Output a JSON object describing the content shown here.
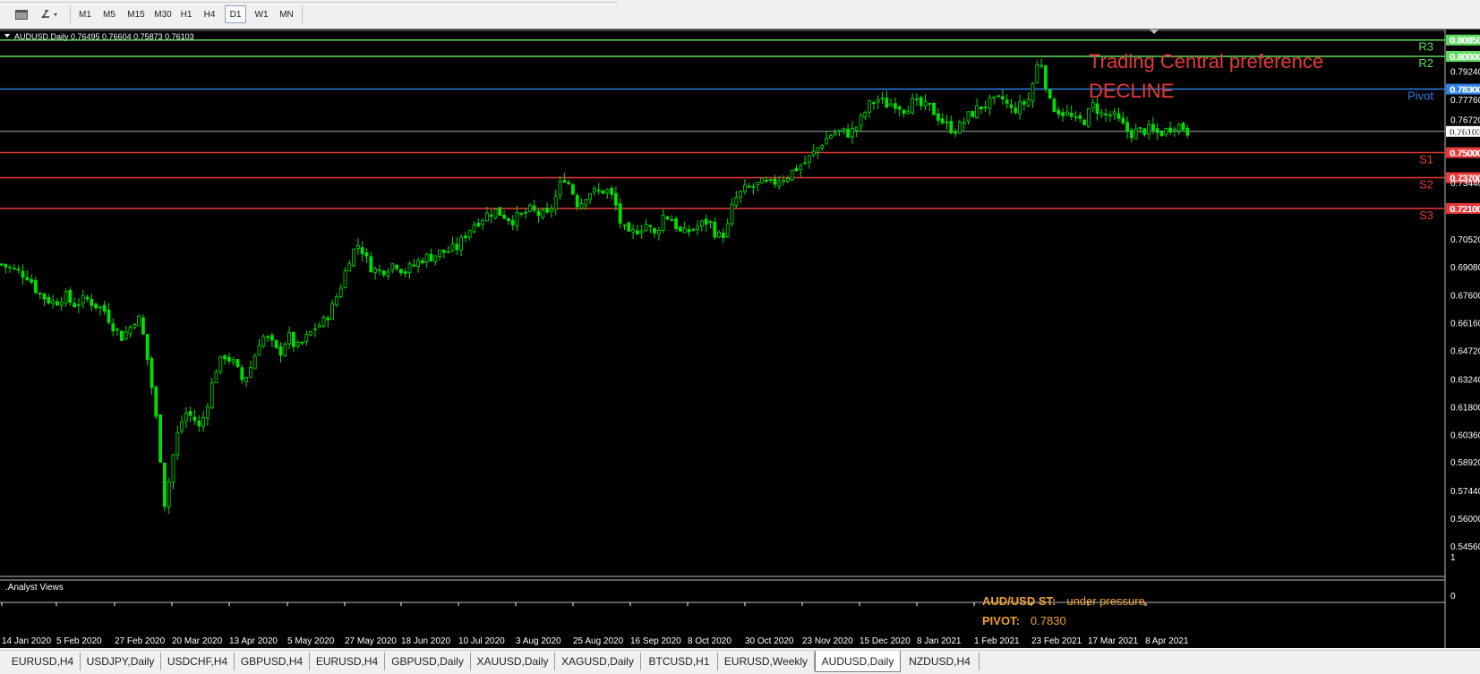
{
  "toolbar": {
    "timeframes": [
      "M1",
      "M5",
      "M15",
      "M30",
      "H1",
      "H4",
      "D1",
      "W1",
      "MN"
    ],
    "active_timeframe": "D1",
    "icons": [
      "chart-window-icon",
      "drawing-tools-icon"
    ]
  },
  "chart": {
    "header": "AUDUSD,Daily  0.76495 0.76604 0.75873 0.76103",
    "symbol": "AUDUSD",
    "timeframe": "Daily",
    "ohlc": {
      "open": "0.76495",
      "high": "0.76604",
      "low": "0.75873",
      "close": "0.76103"
    },
    "current_price": "0.76103",
    "candle_color": "#00e000",
    "price_scale": [
      "0.80850",
      "0.80000",
      "0.79240",
      "0.78300",
      "0.77760",
      "0.76720",
      "0.76103",
      "0.75000",
      "0.73700",
      "0.73440",
      "0.72100",
      "0.70520",
      "0.69080",
      "0.67600",
      "0.66160",
      "0.64720",
      "0.63240",
      "0.61800",
      "0.60360",
      "0.58920",
      "0.57440",
      "0.56000",
      "0.54560"
    ],
    "levels": [
      {
        "name": "R3",
        "value": "0.80850",
        "color": "#5fdc5f"
      },
      {
        "name": "R2",
        "value": "0.80000",
        "color": "#5fdc5f"
      },
      {
        "name": "Pivot",
        "value": "0.78300",
        "color": "#2f7fe8"
      },
      {
        "name": "S1",
        "value": "0.75000",
        "color": "#e83838"
      },
      {
        "name": "S2",
        "value": "0.73700",
        "color": "#e83838"
      },
      {
        "name": "S3",
        "value": "0.72100",
        "color": "#e83838"
      }
    ],
    "preference_title": "Trading Central preference",
    "preference_value": "DECLINE",
    "preference_color": "#e83838",
    "time_axis": [
      "14 Jan 2020",
      "5 Feb 2020",
      "27 Feb 2020",
      "20 Mar 2020",
      "13 Apr 2020",
      "5 May 2020",
      "27 May 2020",
      "18 Jun 2020",
      "10 Jul 2020",
      "3 Aug 2020",
      "25 Aug 2020",
      "16 Sep 2020",
      "8 Oct 2020",
      "30 Oct 2020",
      "23 Nov 2020",
      "15 Dec 2020",
      "8 Jan 2021",
      "1 Feb 2021",
      "23 Feb 2021",
      "17 Mar 2021",
      "8 Apr 2021"
    ]
  },
  "indicator": {
    "name": ".Analyst Views",
    "scale": [
      "1",
      "0"
    ],
    "rows": [
      {
        "key": "AUD/USD ST:",
        "value": "under pressure."
      },
      {
        "key": "PIVOT:",
        "value": "0.7830"
      }
    ]
  },
  "tabs": [
    "EURUSD,H4",
    "USDJPY,Daily",
    "USDCHF,H4",
    "GBPUSD,H4",
    "EURUSD,H4",
    "GBPUSD,Daily",
    "XAUUSD,Daily",
    "XAGUSD,Daily",
    "BTCUSD,H1",
    "EURUSD,Weekly",
    "AUDUSD,Daily",
    "NZDUSD,H4"
  ],
  "active_tab": "AUDUSD,Daily",
  "price_path": [
    [
      0,
      0.692
    ],
    [
      10,
      0.69
    ],
    [
      20,
      0.688
    ],
    [
      30,
      0.686
    ],
    [
      40,
      0.678
    ],
    [
      50,
      0.674
    ],
    [
      60,
      0.672
    ],
    [
      70,
      0.676
    ],
    [
      80,
      0.671
    ],
    [
      95,
      0.674
    ],
    [
      105,
      0.671
    ],
    [
      115,
      0.668
    ],
    [
      125,
      0.66
    ],
    [
      135,
      0.654
    ],
    [
      145,
      0.66
    ],
    [
      152,
      0.666
    ],
    [
      158,
      0.656
    ],
    [
      165,
      0.638
    ],
    [
      172,
      0.615
    ],
    [
      178,
      0.59
    ],
    [
      183,
      0.565
    ],
    [
      188,
      0.582
    ],
    [
      195,
      0.601
    ],
    [
      205,
      0.615
    ],
    [
      215,
      0.612
    ],
    [
      222,
      0.606
    ],
    [
      230,
      0.62
    ],
    [
      240,
      0.638
    ],
    [
      250,
      0.645
    ],
    [
      260,
      0.64
    ],
    [
      270,
      0.631
    ],
    [
      280,
      0.64
    ],
    [
      290,
      0.655
    ],
    [
      300,
      0.652
    ],
    [
      310,
      0.645
    ],
    [
      320,
      0.655
    ],
    [
      330,
      0.648
    ],
    [
      340,
      0.653
    ],
    [
      350,
      0.659
    ],
    [
      360,
      0.662
    ],
    [
      370,
      0.67
    ],
    [
      380,
      0.682
    ],
    [
      390,
      0.697
    ],
    [
      400,
      0.703
    ],
    [
      410,
      0.692
    ],
    [
      420,
      0.688
    ],
    [
      430,
      0.69
    ],
    [
      440,
      0.693
    ],
    [
      450,
      0.688
    ],
    [
      460,
      0.691
    ],
    [
      470,
      0.695
    ],
    [
      480,
      0.696
    ],
    [
      490,
      0.698
    ],
    [
      500,
      0.699
    ],
    [
      510,
      0.701
    ],
    [
      520,
      0.709
    ],
    [
      530,
      0.714
    ],
    [
      540,
      0.717
    ],
    [
      550,
      0.72
    ],
    [
      560,
      0.718
    ],
    [
      570,
      0.715
    ],
    [
      580,
      0.717
    ],
    [
      590,
      0.72
    ],
    [
      600,
      0.718
    ],
    [
      610,
      0.717
    ],
    [
      620,
      0.728
    ],
    [
      628,
      0.738
    ],
    [
      635,
      0.733
    ],
    [
      645,
      0.722
    ],
    [
      655,
      0.73
    ],
    [
      665,
      0.729
    ],
    [
      675,
      0.731
    ],
    [
      685,
      0.725
    ],
    [
      690,
      0.715
    ],
    [
      700,
      0.706
    ],
    [
      710,
      0.71
    ],
    [
      720,
      0.713
    ],
    [
      730,
      0.707
    ],
    [
      740,
      0.718
    ],
    [
      750,
      0.715
    ],
    [
      760,
      0.707
    ],
    [
      770,
      0.71
    ],
    [
      780,
      0.712
    ],
    [
      790,
      0.715
    ],
    [
      800,
      0.706
    ],
    [
      810,
      0.709
    ],
    [
      818,
      0.725
    ],
    [
      828,
      0.73
    ],
    [
      838,
      0.732
    ],
    [
      848,
      0.734
    ],
    [
      858,
      0.733
    ],
    [
      868,
      0.736
    ],
    [
      878,
      0.738
    ],
    [
      888,
      0.742
    ],
    [
      898,
      0.745
    ],
    [
      908,
      0.75
    ],
    [
      918,
      0.756
    ],
    [
      928,
      0.76
    ],
    [
      938,
      0.761
    ],
    [
      948,
      0.76
    ],
    [
      958,
      0.765
    ],
    [
      968,
      0.774
    ],
    [
      978,
      0.778
    ],
    [
      988,
      0.775
    ],
    [
      998,
      0.776
    ],
    [
      1008,
      0.773
    ],
    [
      1018,
      0.776
    ],
    [
      1028,
      0.774
    ],
    [
      1038,
      0.773
    ],
    [
      1048,
      0.768
    ],
    [
      1058,
      0.763
    ],
    [
      1068,
      0.762
    ],
    [
      1078,
      0.768
    ],
    [
      1088,
      0.772
    ],
    [
      1098,
      0.775
    ],
    [
      1108,
      0.776
    ],
    [
      1118,
      0.778
    ],
    [
      1128,
      0.772
    ],
    [
      1138,
      0.774
    ],
    [
      1148,
      0.778
    ],
    [
      1155,
      0.792
    ],
    [
      1160,
      0.8
    ],
    [
      1165,
      0.79
    ],
    [
      1170,
      0.776
    ],
    [
      1180,
      0.772
    ],
    [
      1190,
      0.77
    ],
    [
      1200,
      0.766
    ],
    [
      1210,
      0.767
    ],
    [
      1220,
      0.775
    ],
    [
      1230,
      0.769
    ],
    [
      1240,
      0.77
    ],
    [
      1250,
      0.765
    ],
    [
      1260,
      0.76
    ],
    [
      1270,
      0.761
    ],
    [
      1280,
      0.762
    ],
    [
      1290,
      0.76
    ],
    [
      1300,
      0.761
    ],
    [
      1310,
      0.765
    ],
    [
      1320,
      0.763
    ],
    [
      1325,
      0.761
    ]
  ]
}
